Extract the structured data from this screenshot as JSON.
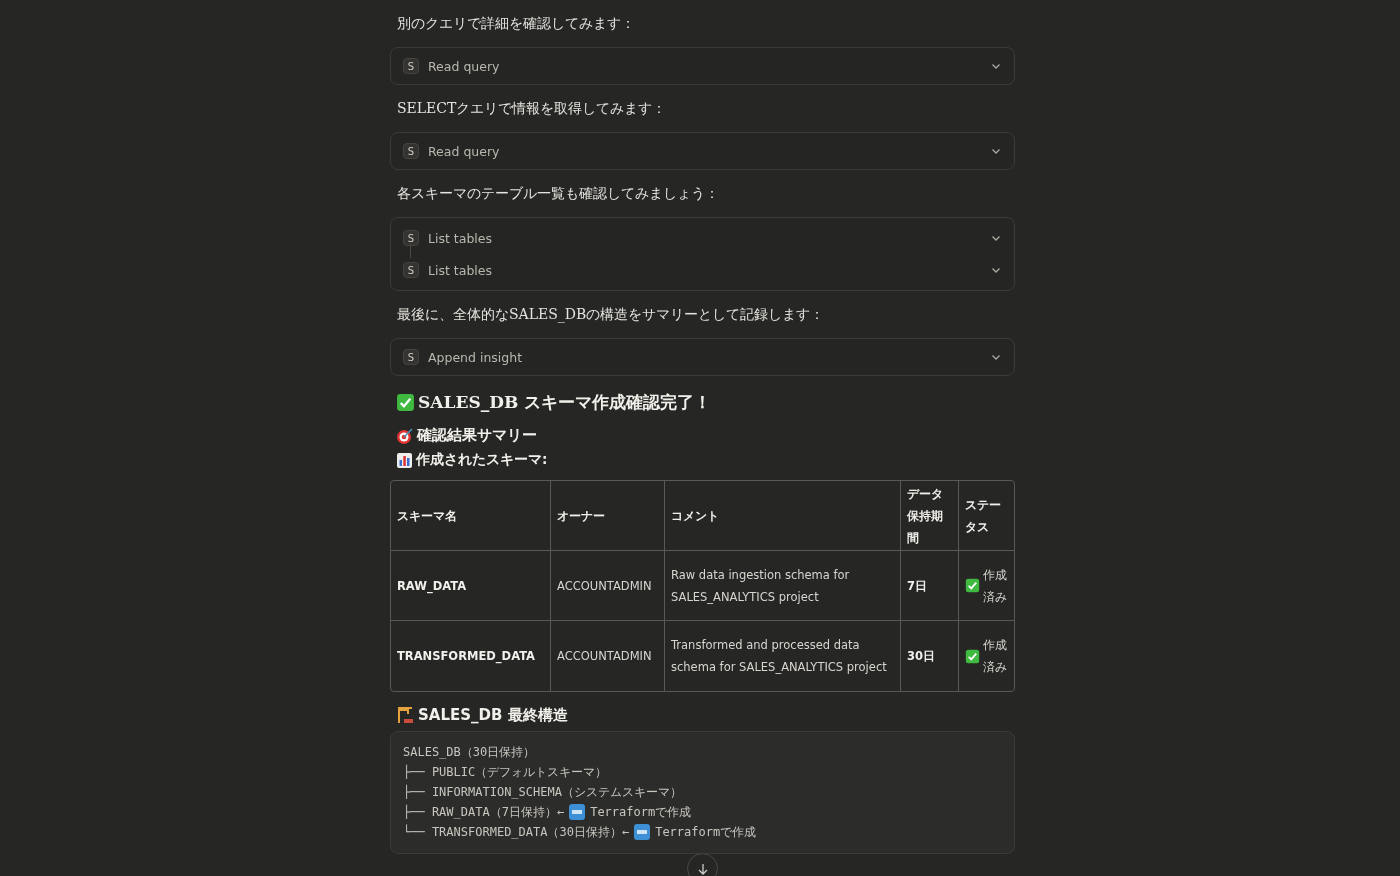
{
  "blocks": [
    {
      "kind": "text",
      "text": "別のクエリで詳細を確認してみます："
    },
    {
      "kind": "tools",
      "items": [
        {
          "letter": "S",
          "label": "Read query"
        }
      ]
    },
    {
      "kind": "text",
      "text": "SELECTクエリで情報を取得してみます："
    },
    {
      "kind": "tools",
      "items": [
        {
          "letter": "S",
          "label": "Read query"
        }
      ]
    },
    {
      "kind": "text",
      "text": "各スキーマのテーブル一覧も確認してみましょう："
    },
    {
      "kind": "tools",
      "items": [
        {
          "letter": "S",
          "label": "List tables"
        },
        {
          "letter": "S",
          "label": "List tables"
        }
      ]
    },
    {
      "kind": "text",
      "text": "最後に、全体的なSALES_DBの構造をサマリーとして記録します："
    },
    {
      "kind": "tools",
      "items": [
        {
          "letter": "S",
          "label": "Append insight"
        }
      ]
    },
    {
      "kind": "h1",
      "text": "SALES_DB スキーマ作成確認完了！"
    },
    {
      "kind": "h2",
      "text": "確認結果サマリー"
    },
    {
      "kind": "h3",
      "text": "作成されたスキーマ:"
    },
    {
      "kind": "table",
      "columns": [
        "スキーマ名",
        "オーナー",
        "コメント",
        "データ保持期間",
        "ステータス"
      ],
      "rows": [
        [
          "RAW_DATA",
          "ACCOUNTADMIN",
          "Raw data ingestion schema for SALES_ANALYTICS project",
          "7日",
          "作成済み"
        ],
        [
          "TRANSFORMED_DATA",
          "ACCOUNTADMIN",
          "Transformed and processed data schema for SALES_ANALYTICS project",
          "30日",
          "作成済み"
        ]
      ]
    },
    {
      "kind": "h2",
      "text": "SALES_DB 最終構造"
    },
    {
      "kind": "code",
      "lines": [
        {
          "kind": "plain",
          "text": "SALES_DB（30日保持）"
        },
        {
          "kind": "plain",
          "text": "├── PUBLIC（デフォルトスキーマ）"
        },
        {
          "kind": "plain",
          "text": "├── INFORMATION_SCHEMA（システムスキーマ）"
        },
        {
          "kind": "created",
          "text": "├── RAW_DATA（7日保持）←",
          "after": "Terraformで作成"
        },
        {
          "kind": "created",
          "text": "└── TRANSFORMED_DATA（30日保持）←",
          "after": "Terraformで作成"
        }
      ]
    }
  ]
}
